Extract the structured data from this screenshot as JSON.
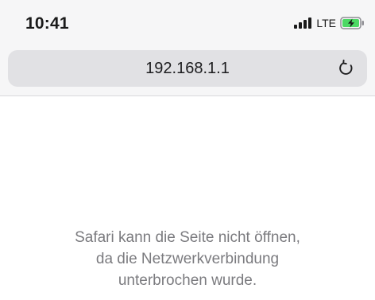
{
  "status_bar": {
    "time": "10:41",
    "network": "LTE",
    "signal_icon": "signal-bars-icon",
    "battery_icon": "battery-charging-icon",
    "battery_color": "#4cd964"
  },
  "browser": {
    "address": "192.168.1.1",
    "reload_icon": "reload-icon"
  },
  "error": {
    "lines": [
      "Safari kann die Seite nicht öffnen,",
      "da die Netzwerkverbindung",
      "unterbrochen wurde."
    ]
  },
  "colors": {
    "chrome_background": "#f6f6f7",
    "address_bar": "#e1e1e4",
    "message_text": "#7b7b7f"
  }
}
